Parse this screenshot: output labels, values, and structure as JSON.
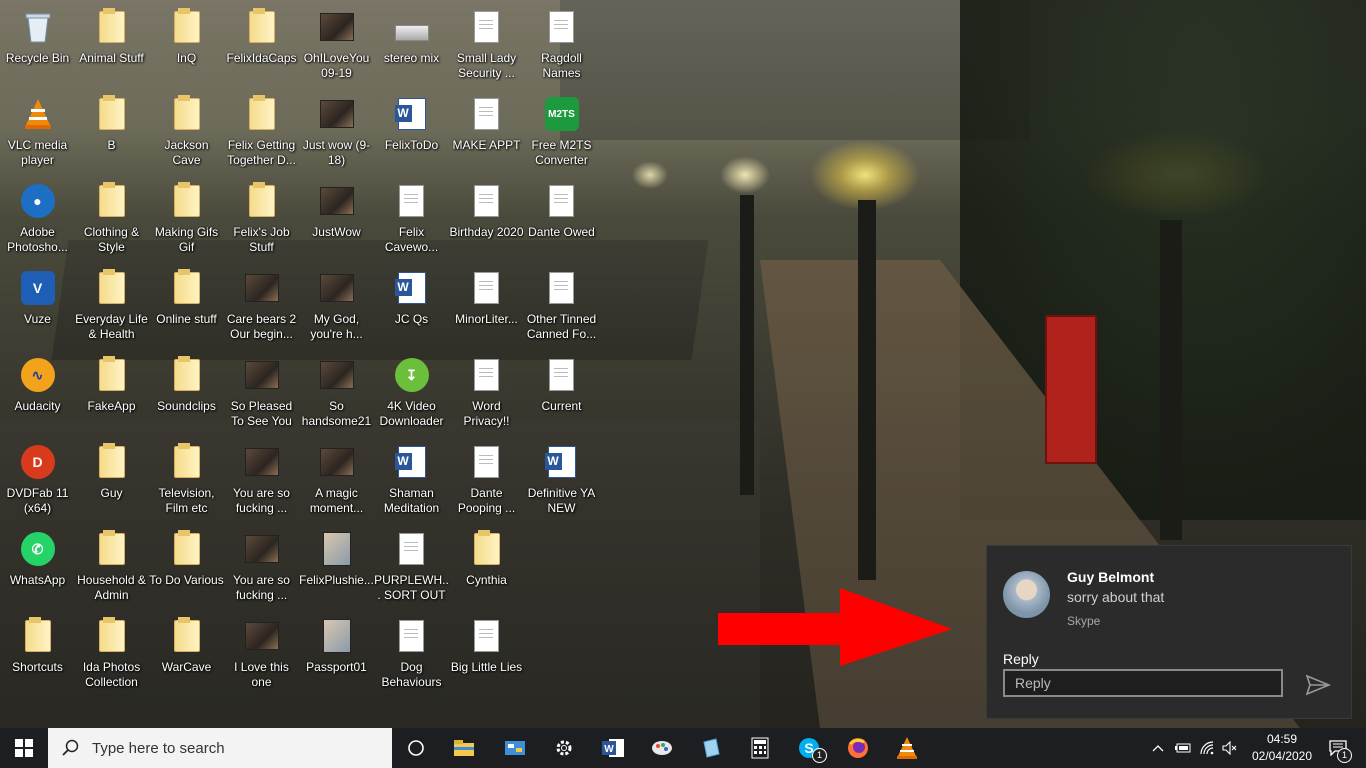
{
  "desktop": {
    "icons": [
      {
        "label": "Recycle Bin",
        "icon": "recycle-bin-icon"
      },
      {
        "label": "Animal Stuff",
        "icon": "folder-icon"
      },
      {
        "label": "InQ",
        "icon": "folder-icon"
      },
      {
        "label": "FelixIdaCaps",
        "icon": "folder-icon"
      },
      {
        "label": "OhILoveYou 09-19",
        "icon": "video-thumbnail-icon"
      },
      {
        "label": "stereo mix",
        "icon": "audio-device-icon"
      },
      {
        "label": "Small Lady Security ...",
        "icon": "text-document-icon"
      },
      {
        "label": "Ragdoll Names",
        "icon": "text-document-icon"
      },
      {
        "label": "VLC media player",
        "icon": "vlc-icon"
      },
      {
        "label": "B",
        "icon": "folder-icon"
      },
      {
        "label": "Jackson Cave",
        "icon": "folder-icon"
      },
      {
        "label": "Felix Getting Together D...",
        "icon": "folder-icon"
      },
      {
        "label": "Just wow (9-18)",
        "icon": "video-thumbnail-icon"
      },
      {
        "label": "FelixToDo",
        "icon": "word-document-icon"
      },
      {
        "label": "MAKE APPT",
        "icon": "text-document-icon"
      },
      {
        "label": "Free M2TS Converter",
        "icon": "m2ts-converter-icon"
      },
      {
        "label": "Adobe Photosho...",
        "icon": "photoshop-icon"
      },
      {
        "label": "Clothing & Style",
        "icon": "folder-icon"
      },
      {
        "label": "Making Gifs Gif",
        "icon": "folder-icon"
      },
      {
        "label": "Felix's Job Stuff",
        "icon": "folder-icon"
      },
      {
        "label": "JustWow",
        "icon": "video-thumbnail-icon"
      },
      {
        "label": "Felix Cavewo...",
        "icon": "text-document-icon"
      },
      {
        "label": "Birthday 2020",
        "icon": "text-document-icon"
      },
      {
        "label": "Dante Owed",
        "icon": "text-document-icon"
      },
      {
        "label": "Vuze",
        "icon": "vuze-icon"
      },
      {
        "label": "Everyday Life & Health",
        "icon": "folder-icon"
      },
      {
        "label": "Online stuff",
        "icon": "folder-icon"
      },
      {
        "label": "Care bears 2 Our begin...",
        "icon": "video-thumbnail-icon"
      },
      {
        "label": "My God, you're h...",
        "icon": "video-thumbnail-icon"
      },
      {
        "label": "JC Qs",
        "icon": "word-document-icon"
      },
      {
        "label": "MinorLiter...",
        "icon": "text-document-icon"
      },
      {
        "label": "Other Tinned Canned Fo...",
        "icon": "text-document-icon"
      },
      {
        "label": "Audacity",
        "icon": "audacity-icon"
      },
      {
        "label": "FakeApp",
        "icon": "folder-icon"
      },
      {
        "label": "Soundclips",
        "icon": "folder-icon"
      },
      {
        "label": "So Pleased To See You [pr...",
        "icon": "video-thumbnail-icon"
      },
      {
        "label": "So handsome21",
        "icon": "video-thumbnail-icon"
      },
      {
        "label": "4K Video Downloader",
        "icon": "4k-video-downloader-icon"
      },
      {
        "label": "Word Privacy!!",
        "icon": "text-document-icon"
      },
      {
        "label": "Current",
        "icon": "text-document-icon"
      },
      {
        "label": "DVDFab 11 (x64)",
        "icon": "dvdfab-icon"
      },
      {
        "label": "Guy",
        "icon": "folder-icon"
      },
      {
        "label": "Television, Film etc",
        "icon": "folder-icon"
      },
      {
        "label": "You are so fucking ...",
        "icon": "video-thumbnail-icon"
      },
      {
        "label": "A magic moment...",
        "icon": "video-thumbnail-icon"
      },
      {
        "label": "Shaman Meditation",
        "icon": "word-document-icon"
      },
      {
        "label": "Dante Pooping ...",
        "icon": "text-document-icon"
      },
      {
        "label": "Definitive YA NEW",
        "icon": "word-document-icon"
      },
      {
        "label": "WhatsApp",
        "icon": "whatsapp-icon"
      },
      {
        "label": "Household & Admin",
        "icon": "folder-icon"
      },
      {
        "label": "To Do Various",
        "icon": "folder-icon"
      },
      {
        "label": "You are so fucking ...",
        "icon": "video-thumbnail-icon"
      },
      {
        "label": "FelixPlushie...",
        "icon": "image-thumbnail-icon"
      },
      {
        "label": "PURPLEWH... SORT OUT",
        "icon": "text-document-icon"
      },
      {
        "label": "Cynthia",
        "icon": "folder-icon"
      },
      {
        "label": "Shortcuts",
        "icon": "folder-icon"
      },
      {
        "label": "Ida Photos Collection",
        "icon": "folder-icon"
      },
      {
        "label": "WarCave",
        "icon": "folder-icon"
      },
      {
        "label": "I Love this one",
        "icon": "video-thumbnail-icon"
      },
      {
        "label": "Passport01",
        "icon": "image-thumbnail-icon"
      },
      {
        "label": "Dog Behaviours",
        "icon": "text-document-icon"
      },
      {
        "label": "Big Little Lies",
        "icon": "text-document-icon"
      }
    ]
  },
  "notification": {
    "sender": "Guy Belmont",
    "message": "sorry about that",
    "app": "Skype",
    "reply_label": "Reply",
    "reply_placeholder": "Reply",
    "send_icon": "send-icon"
  },
  "annotation": {
    "arrow_color": "#ff0000"
  },
  "taskbar": {
    "search_placeholder": "Type here to search",
    "pinned": [
      {
        "name": "task-view-icon"
      },
      {
        "name": "file-explorer-icon"
      },
      {
        "name": "control-panel-icon"
      },
      {
        "name": "settings-icon"
      },
      {
        "name": "word-icon"
      },
      {
        "name": "paint-icon"
      },
      {
        "name": "notepad-icon"
      },
      {
        "name": "calculator-icon"
      },
      {
        "name": "skype-icon",
        "badge": "1"
      },
      {
        "name": "firefox-icon"
      },
      {
        "name": "vlc-icon"
      }
    ],
    "clock": {
      "time": "04:59",
      "date": "02/04/2020"
    },
    "notification_count": "1",
    "colors": {
      "taskbar": "#1c1e22",
      "search_bg": "#f3f3f3",
      "word_blue": "#2b579a",
      "skype_blue": "#00aff0"
    }
  }
}
